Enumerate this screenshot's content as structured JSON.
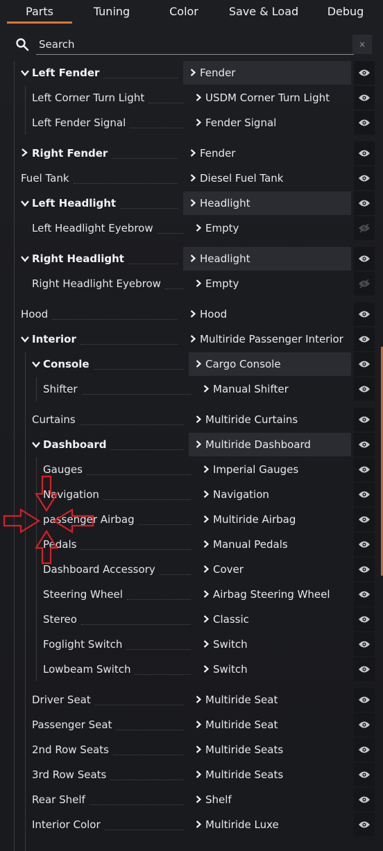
{
  "tabs": [
    {
      "label": "Parts",
      "active": true
    },
    {
      "label": "Tuning",
      "active": false
    },
    {
      "label": "Color",
      "active": false
    },
    {
      "label": "Save & Load",
      "active": false
    },
    {
      "label": "Debug",
      "active": false
    }
  ],
  "search": {
    "placeholder": "Search",
    "clear_label": "×"
  },
  "accent_color": "#e0743b",
  "rows": [
    {
      "name": "Left Fender",
      "level": 1,
      "expanded": true,
      "part": "Fender",
      "part_level": 0,
      "highlight": true,
      "visible": true
    },
    {
      "name": "Left Corner Turn Light",
      "level": 2,
      "part": "USDM Corner Turn Light",
      "part_level": 1,
      "highlight": false,
      "visible": true
    },
    {
      "name": "Left Fender Signal",
      "level": 2,
      "part": "Fender Signal",
      "part_level": 1,
      "highlight": false,
      "visible": true
    },
    {
      "name": "Right Fender",
      "level": 1,
      "expanded": false,
      "part": "Fender",
      "part_level": 0,
      "highlight": false,
      "visible": true
    },
    {
      "name": "Fuel Tank",
      "level": 0,
      "part": "Diesel Fuel Tank",
      "part_level": 0,
      "highlight": false,
      "visible": true
    },
    {
      "name": "Left Headlight",
      "level": 1,
      "expanded": true,
      "part": "Headlight",
      "part_level": 0,
      "highlight": true,
      "visible": true
    },
    {
      "name": "Left Headlight Eyebrow",
      "level": 2,
      "part": "Empty",
      "part_level": 1,
      "highlight": false,
      "visible": false
    },
    {
      "name": "Right Headlight",
      "level": 1,
      "expanded": true,
      "part": "Headlight",
      "part_level": 0,
      "highlight": true,
      "visible": true
    },
    {
      "name": "Right Headlight Eyebrow",
      "level": 2,
      "part": "Empty",
      "part_level": 1,
      "highlight": false,
      "visible": false
    },
    {
      "name": "Hood",
      "level": 0,
      "part": "Hood",
      "part_level": 0,
      "highlight": false,
      "visible": true
    },
    {
      "name": "Interior",
      "level": 1,
      "expanded": true,
      "part": "Multiride Passenger Interior",
      "part_level": 0,
      "highlight": false,
      "visible": true
    },
    {
      "name": "Console",
      "level": 2,
      "expanded": true,
      "part": "Cargo Console",
      "part_level": 1,
      "highlight": true,
      "visible": true
    },
    {
      "name": "Shifter",
      "level": 3,
      "part": "Manual Shifter",
      "part_level": 2,
      "highlight": false,
      "visible": true
    },
    {
      "name": "Curtains",
      "level": 2,
      "part": "Multiride Curtains",
      "part_level": 1,
      "highlight": false,
      "visible": true
    },
    {
      "name": "Dashboard",
      "level": 2,
      "expanded": true,
      "part": "Multiride Dashboard",
      "part_level": 1,
      "highlight": true,
      "visible": true
    },
    {
      "name": "Gauges",
      "level": 3,
      "part": "Imperial Gauges",
      "part_level": 2,
      "highlight": false,
      "visible": true
    },
    {
      "name": "Navigation",
      "level": 3,
      "part": "Navigation",
      "part_level": 2,
      "highlight": false,
      "visible": true
    },
    {
      "name": "passenger Airbag",
      "level": 3,
      "part": "Multiride Airbag",
      "part_level": 2,
      "highlight": false,
      "visible": true
    },
    {
      "name": "Pedals",
      "level": 3,
      "part": "Manual Pedals",
      "part_level": 2,
      "highlight": false,
      "visible": true
    },
    {
      "name": "Dashboard Accessory",
      "level": 3,
      "part": "Cover",
      "part_level": 2,
      "highlight": false,
      "visible": true
    },
    {
      "name": "Steering Wheel",
      "level": 3,
      "part": "Airbag Steering Wheel",
      "part_level": 2,
      "highlight": false,
      "visible": true
    },
    {
      "name": "Stereo",
      "level": 3,
      "part": "Classic",
      "part_level": 2,
      "highlight": false,
      "visible": true
    },
    {
      "name": "Foglight Switch",
      "level": 3,
      "part": "Switch",
      "part_level": 2,
      "highlight": false,
      "visible": true
    },
    {
      "name": "Lowbeam Switch",
      "level": 3,
      "part": "Switch",
      "part_level": 2,
      "highlight": false,
      "visible": true
    },
    {
      "name": "Driver Seat",
      "level": 2,
      "part": "Multiride Seat",
      "part_level": 1,
      "highlight": false,
      "visible": true
    },
    {
      "name": "Passenger Seat",
      "level": 2,
      "part": "Multiride Seat",
      "part_level": 1,
      "highlight": false,
      "visible": true
    },
    {
      "name": "2nd Row Seats",
      "level": 2,
      "part": "Multiride Seats",
      "part_level": 1,
      "highlight": false,
      "visible": true
    },
    {
      "name": "3rd Row Seats",
      "level": 2,
      "part": "Multiride Seats",
      "part_level": 1,
      "highlight": false,
      "visible": true
    },
    {
      "name": "Rear Shelf",
      "level": 2,
      "part": "Shelf",
      "part_level": 1,
      "highlight": false,
      "visible": true
    },
    {
      "name": "Interior Color",
      "level": 2,
      "part": "Multiride Luxe",
      "part_level": 1,
      "highlight": false,
      "visible": true
    }
  ]
}
